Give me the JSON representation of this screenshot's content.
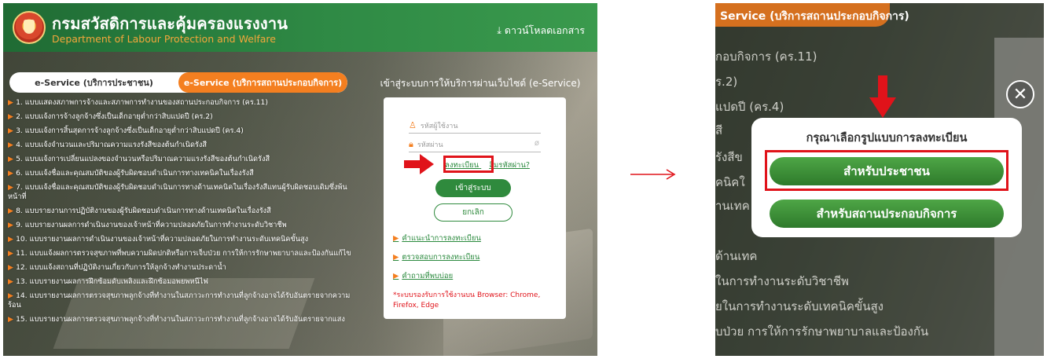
{
  "left": {
    "header": {
      "title_th": "กรมสวัสดิการและคุ้มครองแรงงาน",
      "title_en": "Department of Labour Protection and Welfare",
      "download": "⤓ ดาวน์โหลดเอกสาร"
    },
    "tabs": {
      "people": "e-Service (บริการประชาชน)",
      "business": "e-Service (บริการสถานประกอบกิจการ)"
    },
    "forms": [
      "1. แบบแสดงสภาพการจ้างและสภาพการทำงานของสถานประกอบกิจการ (คร.11)",
      "2. แบบแจ้งการจ้างลูกจ้างซึ่งเป็นเด็กอายุต่ำกว่าสิบแปดปี (คร.2)",
      "3. แบบแจ้งการสิ้นสุดการจ้างลูกจ้างซึ่งเป็นเด็กอายุต่ำกว่าสิบแปดปี (คร.4)",
      "4. แบบแจ้งจำนวนและปริมาณความแรงรังสีของต้นกำเนิดรังสี",
      "5. แบบแจ้งการเปลี่ยนแปลงของจำนวนหรือปริมาณความแรงรังสีของต้นกำเนิดรังสี",
      "6. แบบแจ้งชื่อและคุณสมบัติของผู้รับผิดชอบดำเนินการทางเทคนิคในเรื่องรังสี",
      "7. แบบแจ้งชื่อและคุณสมบัติของผู้รับผิดชอบดำเนินการทางด้านเทคนิคในเรื่องรังสีแทนผู้รับผิดชอบเดิมซึ่งพ้นหน้าที่",
      "8. แบบรายงานการปฏิบัติงานของผู้รับผิดชอบดำเนินการทางด้านเทคนิคในเรื่องรังสี",
      "9. แบบรายงานผลการดำเนินงานของเจ้าหน้าที่ความปลอดภัยในการทำงานระดับวิชาชีพ",
      "10. แบบรายงานผลการดำเนินงานของเจ้าหน้าที่ความปลอดภัยในการทำงานระดับเทคนิคขั้นสูง",
      "11. แบบแจ้งผลการตรวจสุขภาพที่พบความผิดปกติหรือการเจ็บป่วย การให้การรักษาพยาบาลและป้องกันแก้ไข",
      "12. แบบแจ้งสถานที่ปฏิบัติงานเกี่ยวกับการให้ลูกจ้างทำงานประดาน้ำ",
      "13. แบบรายงานผลการฝึกซ้อมดับเพลิงและฝึกซ้อมอพยพหนีไฟ",
      "14. แบบรายงานผลการตรวจสุขภาพลูกจ้างที่ทำงานในสภาวะการทำงานที่ลูกจ้างอาจได้รับอันตรายจากความร้อน",
      "15. แบบรายงานผลการตรวจสุขภาพลูกจ้างที่ทำงานในสภาวะการทำงานที่ลูกจ้างอาจได้รับอันตรายจากแสง"
    ],
    "login": {
      "heading": "เข้าสู่ระบบการให้บริการผ่านเว็บไซต์ (e-Service)",
      "username_placeholder": "รหัสผู้ใช้งาน",
      "password_placeholder": "รหัสผ่าน",
      "register_link": "ลงทะเบียน",
      "forgot_link": "ลืมรหัสผ่าน?",
      "login_button": "เข้าสู่ระบบ",
      "cancel_button": "ยกเลิก",
      "help_links": [
        "คำแนะนำการลงทะเบียน",
        "ตรวจสอบการลงทะเบียน",
        "คำถามที่พบบ่อย"
      ],
      "browser_note": "*ระบบรองรับการใช้งานบน Browser: Chrome, Firefox, Edge"
    }
  },
  "right": {
    "topbar": "Service (บริการสถานประกอบกิจการ)",
    "background_items": [
      "กอบกิจการ (คร.11)",
      "ร.2)",
      "แปดปี (คร.4)",
      "สี",
      "รังสีข",
      "คนิคใ",
      "านเทค",
      "ด้านเทค",
      "ในการทำงานระดับวิชาชีพ",
      "ยในการทำงานระดับเทคนิคขั้นสูง",
      "บป่วย การให้การรักษาพยาบาลและป้องกัน"
    ],
    "modal": {
      "title": "กรุณาเลือกรูปแบบการลงทะเบียน",
      "people_button": "สำหรับประชาชน",
      "business_button": "สำหรับสถานประกอบกิจการ"
    }
  },
  "colors": {
    "header_green": "#2f8a45",
    "accent_orange": "#f47f20",
    "highlight_red": "#e0131a",
    "button_green": "#3a8e36"
  }
}
